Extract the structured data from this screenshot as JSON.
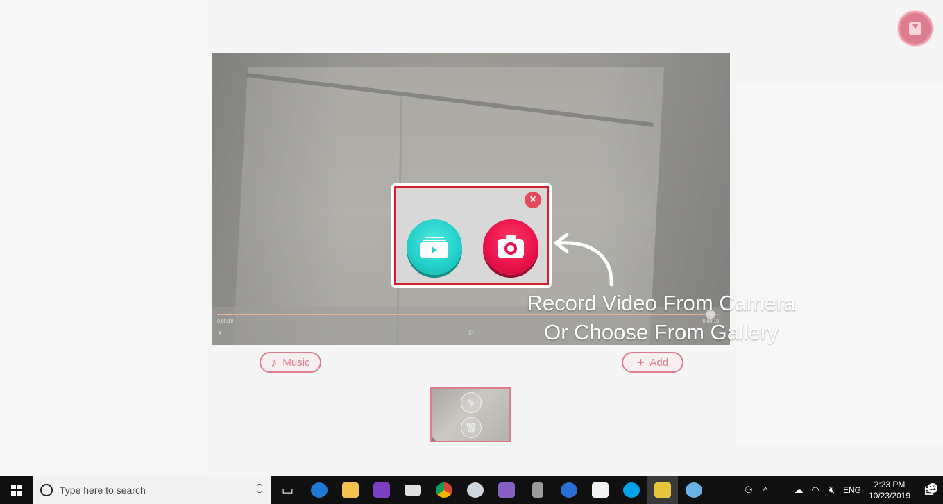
{
  "colors": {
    "accent": "#c3203f",
    "dialog_border": "#d1202f",
    "gallery": "#22cfc8",
    "camera": "#e8114a"
  },
  "toolbar": {
    "export_icon": "export-download-icon"
  },
  "player": {
    "current_time": "0:00:10",
    "end_time": "0:00:10",
    "progress_fraction": 0.98
  },
  "buttons": {
    "music_label": "Music",
    "music_icon": "♪",
    "add_label": "Add",
    "add_icon": "+"
  },
  "thumbnail": {
    "edit_icon": "edit-icon",
    "delete_icon": "trash-icon"
  },
  "dialog": {
    "close_icon": "×",
    "gallery_icon": "gallery-video-icon",
    "camera_icon": "camera-icon"
  },
  "hint": {
    "line1": "Record Video From Camera",
    "line2": "Or Choose From Gallery"
  },
  "taskbar": {
    "search_placeholder": "Type here to search",
    "tray_lang": "ENG",
    "clock_time": "2:23 PM",
    "clock_date": "10/23/2019",
    "notification_count": "12"
  }
}
